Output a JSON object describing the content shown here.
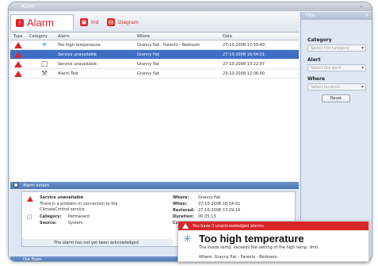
{
  "window": {
    "title": "Alarm"
  },
  "tabs": [
    {
      "label": "Alarm"
    },
    {
      "label": "Ind"
    },
    {
      "label": "Diagram"
    }
  ],
  "grid": {
    "columns": [
      "Type",
      "Category",
      "Alarm",
      "Where",
      "Date"
    ],
    "rows": [
      {
        "alarm": "Too high temperature",
        "where": "Granny flat - Parents - Bedroom",
        "date": "27-10-2008 17:50:49",
        "category_icon": "thermometer-icon",
        "selected": false
      },
      {
        "alarm": "Service unavailable",
        "where": "Granny flat",
        "date": "27-10-2008 16:54:01",
        "category_icon": "none",
        "selected": true
      },
      {
        "alarm": "Service unavailable",
        "where": "Granny flat",
        "date": "27-10-2008 13:22:07",
        "category_icon": "monitor-icon",
        "selected": false
      },
      {
        "alarm": "Alarm Test",
        "where": "Granny flat",
        "date": "23-10-2008 12:06:00",
        "category_icon": "wrench-icon",
        "selected": false
      }
    ]
  },
  "detail": {
    "header": "Alarm details",
    "title": "Service unavailable",
    "description_line1": "There is a problem in connection to the",
    "description_line2": "ClimateControl service",
    "category_label": "Category:",
    "category_value": "Permanent",
    "source_label": "Source:",
    "source_value": "System",
    "note": "The alarm has not yet been acknowledged",
    "where_label": "Where:",
    "where_value": "Granny flat",
    "when_label": "When:",
    "when_value": "27-10-2008 16:54:01",
    "restored_label": "Restored:",
    "restored_value": "27-10-2008 17:29:14",
    "duration_label": "Duration:",
    "duration_value": "00:35:13",
    "code_label": "Code:"
  },
  "bottom_bar": {
    "label": "Out flows"
  },
  "filter": {
    "header": "Filter",
    "category_label": "Category",
    "category_placeholder": "Select the category",
    "alert_label": "Alert",
    "alert_placeholder": "Select the alert",
    "where_label": "Where",
    "where_placeholder": "Select location",
    "reset_label": "Reset"
  },
  "toast": {
    "header": "You have 3 unacknowledged alarms",
    "title": "Too high temperature",
    "message": "The inside temp. exceeds the setting of the high temp. limit.",
    "location": "Where: Granny flat - Parents - Bedroom"
  },
  "colors": {
    "accent_red": "#d9262b",
    "selection_blue": "#3f6fc4",
    "panel_blue": "#4a74b3"
  }
}
